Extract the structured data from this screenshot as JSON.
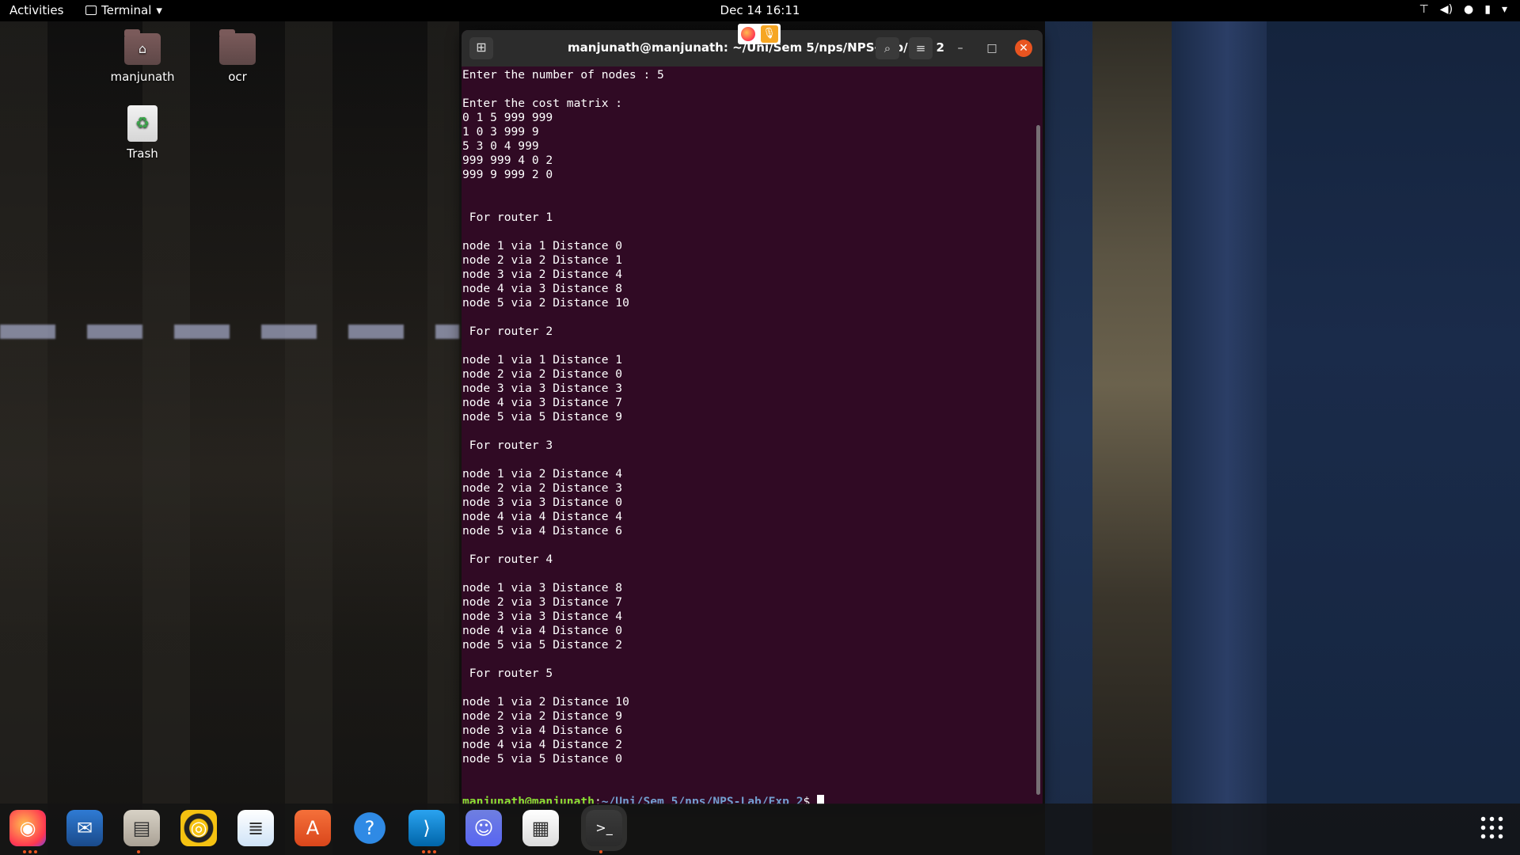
{
  "topbar": {
    "activities": "Activities",
    "app_name": "Terminal",
    "clock": "Dec 14  16:11"
  },
  "desktop": {
    "icons": [
      {
        "label": "manjunath"
      },
      {
        "label": "ocr"
      },
      {
        "label": "Trash"
      }
    ]
  },
  "terminal": {
    "title": "manjunath@manjunath: ~/Uni/Sem 5/nps/NPS-Lab/Exp 2",
    "lines": [
      "Enter the number of nodes : 5",
      "",
      "Enter the cost matrix :",
      "0 1 5 999 999",
      "1 0 3 999 9",
      "5 3 0 4 999",
      "999 999 4 0 2",
      "999 9 999 2 0",
      "",
      "",
      " For router 1",
      "",
      "node 1 via 1 Distance 0",
      "node 2 via 2 Distance 1",
      "node 3 via 2 Distance 4",
      "node 4 via 3 Distance 8",
      "node 5 via 2 Distance 10",
      "",
      " For router 2",
      "",
      "node 1 via 1 Distance 1",
      "node 2 via 2 Distance 0",
      "node 3 via 3 Distance 3",
      "node 4 via 3 Distance 7",
      "node 5 via 5 Distance 9",
      "",
      " For router 3",
      "",
      "node 1 via 2 Distance 4",
      "node 2 via 2 Distance 3",
      "node 3 via 3 Distance 0",
      "node 4 via 4 Distance 4",
      "node 5 via 4 Distance 6",
      "",
      " For router 4",
      "",
      "node 1 via 3 Distance 8",
      "node 2 via 3 Distance 7",
      "node 3 via 3 Distance 4",
      "node 4 via 4 Distance 0",
      "node 5 via 5 Distance 2",
      "",
      " For router 5",
      "",
      "node 1 via 2 Distance 10",
      "node 2 via 2 Distance 9",
      "node 3 via 4 Distance 6",
      "node 4 via 4 Distance 2",
      "node 5 via 5 Distance 0",
      "",
      ""
    ],
    "prompt_user": "manjunath@manjunath",
    "prompt_sep": ":",
    "prompt_path": "~/Uni/Sem 5/nps/NPS-Lab/Exp 2",
    "prompt_symbol": "$ "
  },
  "dock": {
    "items": [
      {
        "name": "firefox-icon",
        "running": true
      },
      {
        "name": "thunderbird-icon",
        "running": false
      },
      {
        "name": "files-icon",
        "running": true
      },
      {
        "name": "rhythmbox-icon",
        "running": false
      },
      {
        "name": "libreoffice-writer-icon",
        "running": false
      },
      {
        "name": "software-center-icon",
        "running": false
      },
      {
        "name": "help-icon",
        "running": false
      },
      {
        "name": "vscode-icon",
        "running": true
      },
      {
        "name": "discord-icon",
        "running": false
      },
      {
        "name": "document-viewer-icon",
        "running": false
      },
      {
        "name": "terminal-icon",
        "running": true
      }
    ]
  },
  "colors": {
    "terminal_bg": "#300a24",
    "prompt_user": "#8ae234",
    "prompt_path": "#729fcf",
    "accent": "#e95420"
  }
}
